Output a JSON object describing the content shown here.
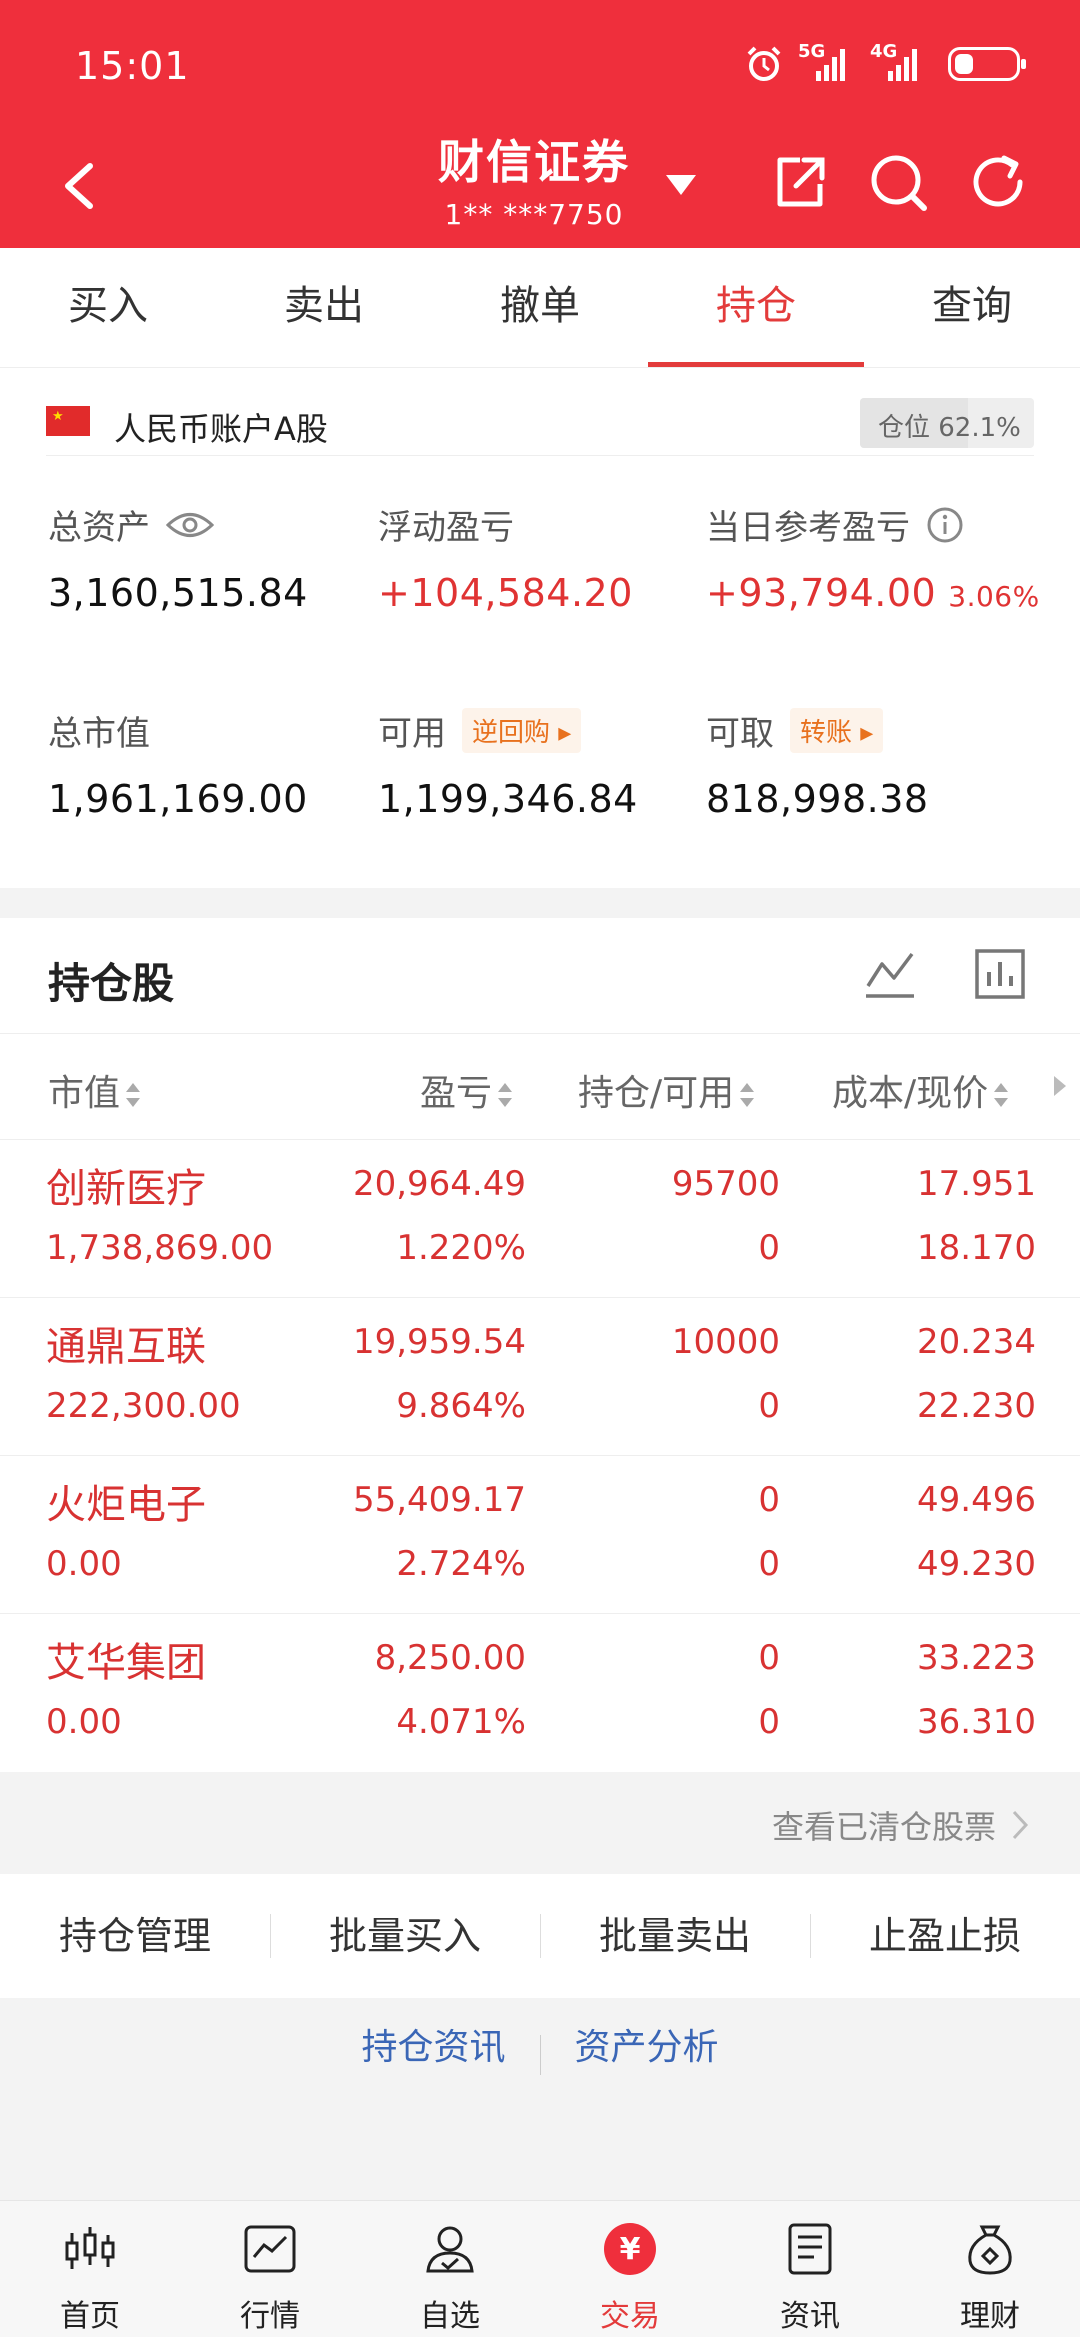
{
  "status": {
    "time": "15:01",
    "sig1": "5G",
    "sig2": "4G"
  },
  "header": {
    "title": "财信证券",
    "account": "1**  ***7750"
  },
  "tabs": [
    {
      "label": "买入"
    },
    {
      "label": "卖出"
    },
    {
      "label": "撤单"
    },
    {
      "label": "持仓",
      "active": true
    },
    {
      "label": "查询"
    }
  ],
  "account": {
    "name": "人民币账户A股",
    "position_label": "仓位 62.1%",
    "position_ratio": 0.621,
    "total_assets_label": "总资产",
    "total_assets": "3,160,515.84",
    "float_pl_label": "浮动盈亏",
    "float_pl": "+104,584.20",
    "day_pl_label": "当日参考盈亏",
    "day_pl": "+93,794.00",
    "day_pl_pct": "3.06%",
    "market_value_label": "总市值",
    "market_value": "1,961,169.00",
    "available_label": "可用",
    "available_tag": "逆回购",
    "available": "1,199,346.84",
    "withdrawable_label": "可取",
    "withdrawable_tag": "转账",
    "withdrawable": "818,998.38"
  },
  "holdings": {
    "title": "持仓股",
    "columns": [
      "市值",
      "盈亏",
      "持仓/可用",
      "成本/现价"
    ],
    "rows": [
      {
        "name": "创新医疗",
        "value": "1,738,869.00",
        "pl": "20,964.49",
        "pl_pct": "1.220%",
        "qty": "95700",
        "avail": "0",
        "cost": "17.951",
        "price": "18.170"
      },
      {
        "name": "通鼎互联",
        "value": "222,300.00",
        "pl": "19,959.54",
        "pl_pct": "9.864%",
        "qty": "10000",
        "avail": "0",
        "cost": "20.234",
        "price": "22.230"
      },
      {
        "name": "火炬电子",
        "value": "0.00",
        "pl": "55,409.17",
        "pl_pct": "2.724%",
        "qty": "0",
        "avail": "0",
        "cost": "49.496",
        "price": "49.230"
      },
      {
        "name": "艾华集团",
        "value": "0.00",
        "pl": "8,250.00",
        "pl_pct": "4.071%",
        "qty": "0",
        "avail": "0",
        "cost": "33.223",
        "price": "36.310"
      }
    ],
    "cleared_link": "查看已清仓股票"
  },
  "actions": [
    "持仓管理",
    "批量买入",
    "批量卖出",
    "止盈止损"
  ],
  "links": [
    "持仓资讯",
    "资产分析"
  ],
  "bottom_nav": [
    {
      "label": "首页",
      "icon": "candlestick-icon"
    },
    {
      "label": "行情",
      "icon": "chart-icon"
    },
    {
      "label": "自选",
      "icon": "user-check-icon"
    },
    {
      "label": "交易",
      "icon": "yen-icon",
      "active": true
    },
    {
      "label": "资讯",
      "icon": "document-icon"
    },
    {
      "label": "理财",
      "icon": "money-bag-icon"
    }
  ],
  "colors": {
    "brand_red": "#ef2f3c",
    "profit_red": "#d83232",
    "link_blue": "#3a66b6",
    "tag_orange": "#e8711e"
  }
}
